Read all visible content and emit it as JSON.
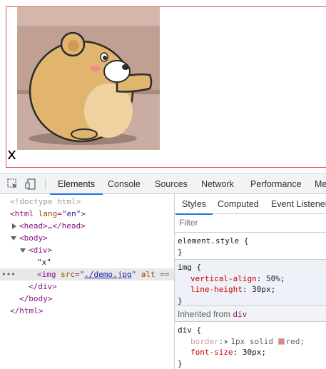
{
  "page": {
    "text_node": "x",
    "image_alt": "cartoon bear pushing",
    "border_color": "#e04848"
  },
  "devtools": {
    "tabs": [
      {
        "label": "Elements",
        "active": true
      },
      {
        "label": "Console",
        "active": false
      },
      {
        "label": "Sources",
        "active": false
      },
      {
        "label": "Network",
        "active": false
      },
      {
        "label": "Performance",
        "active": false
      },
      {
        "label": "Me",
        "active": false
      }
    ],
    "icons": {
      "inspect": "inspect-element-icon",
      "device": "device-toolbar-icon"
    },
    "accent": "#1a73e8"
  },
  "tree": {
    "doctype": "<!doctype html>",
    "html_open": "<html",
    "html_attr": "lang",
    "html_attr_val": "\"en\"",
    "html_close_bracket": ">",
    "head_collapsed": "<head>…</head>",
    "body_open": "<body>",
    "div_open": "<div>",
    "text_node": "\"x\"",
    "img_tag": "<img",
    "img_src_attr": "src",
    "img_src_val": "./demo.jpg",
    "img_alt_attr": "alt",
    "img_trailer": "==",
    "div_close": "</div>",
    "body_close": "</body>",
    "html_close": "</html>",
    "dots": "•••"
  },
  "styles": {
    "sub_tabs": [
      {
        "label": "Styles",
        "active": true
      },
      {
        "label": "Computed",
        "active": false
      },
      {
        "label": "Event Listeners",
        "active": false
      }
    ],
    "filter_placeholder": "Filter",
    "element_style": "element.style {",
    "close_brace": "}",
    "img_rule": {
      "selector": "img {",
      "props": [
        {
          "name": "vertical-align",
          "value": "50%;"
        },
        {
          "name": "line-height",
          "value": "30px;"
        }
      ]
    },
    "inherited_label": "Inherited from",
    "inherited_from": "div",
    "div_rule": {
      "selector": "div {",
      "border_name": "border",
      "border_value_1": "1px solid",
      "border_value_2": "red;",
      "font_name": "font-size",
      "font_value": "30px;"
    }
  }
}
